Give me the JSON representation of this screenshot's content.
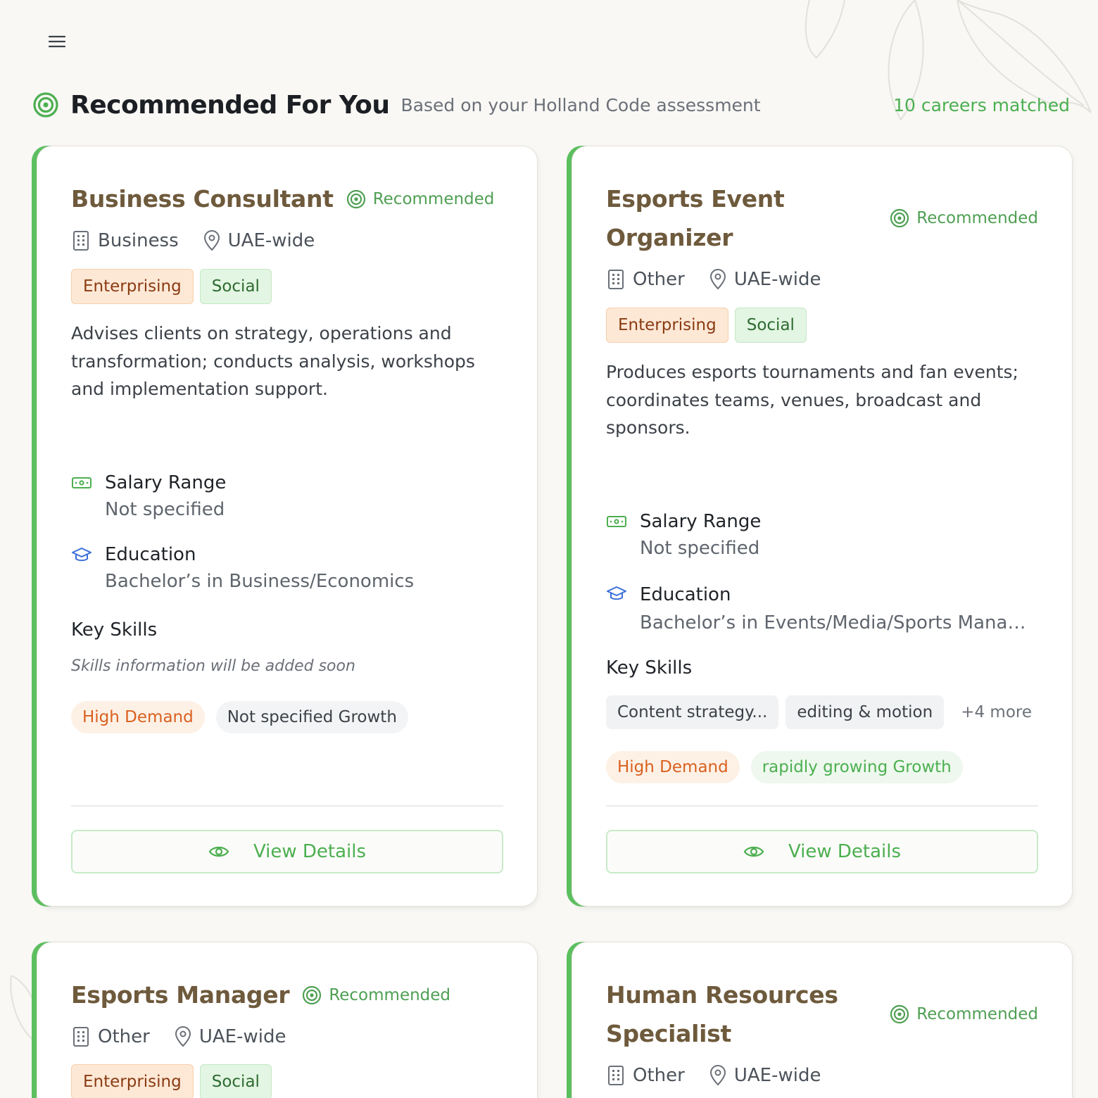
{
  "header": {
    "title": "Recommended For You",
    "subtitle": "Based on your Holland Code assessment",
    "count": "10 careers matched"
  },
  "labels": {
    "recommended": "Recommended",
    "salary": "Salary Range",
    "education": "Education",
    "key_skills": "Key Skills",
    "view_details": "View Details"
  },
  "careers": [
    {
      "title": "Business Consultant",
      "sector": "Business",
      "location": "UAE-wide",
      "tags": [
        "Enterprising",
        "Social"
      ],
      "description": "Advises clients on strategy, operations and transformation; conducts analysis, workshops and implementation support.",
      "salary": "Not specified",
      "education": "Bachelor’s in Business/Economics",
      "skills_empty": "Skills information will be added soon",
      "demand": "High Demand",
      "growth": "Not specified Growth"
    },
    {
      "title_line1": "Esports Event",
      "title_line2": "Organizer",
      "sector": "Other",
      "location": "UAE-wide",
      "tags": [
        "Enterprising",
        "Social"
      ],
      "description": "Produces esports tournaments and fan events; coordinates teams, venues, broadcast and sponsors.",
      "salary": "Not specified",
      "education": "Bachelor’s in Events/Media/Sports Management",
      "skills": [
        "Content strategy...",
        "editing & motion"
      ],
      "skills_more": "+4 more",
      "demand": "High Demand",
      "growth": "rapidly growing Growth"
    },
    {
      "title": "Esports Manager",
      "sector": "Other",
      "location": "UAE-wide",
      "tags": [
        "Enterprising",
        "Social"
      ]
    },
    {
      "title_line1": "Human Resources",
      "title_line2": "Specialist",
      "sector": "Other",
      "location": "UAE-wide"
    }
  ]
}
